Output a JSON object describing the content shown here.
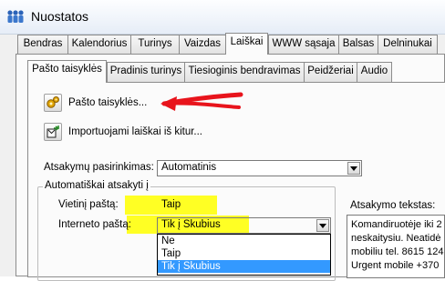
{
  "window": {
    "title": "Nuostatos"
  },
  "outer_tabs": [
    {
      "label": "Bendras"
    },
    {
      "label": "Kalendorius"
    },
    {
      "label": "Turinys"
    },
    {
      "label": "Vaizdas"
    },
    {
      "label": "Laiškai"
    },
    {
      "label": "WWW sąsaja"
    },
    {
      "label": "Balsas"
    },
    {
      "label": "Delninukai"
    }
  ],
  "outer_active_tab": "Laiškai",
  "inner_tabs": [
    {
      "label": "Pašto taisyklės"
    },
    {
      "label": "Pradinis turinys"
    },
    {
      "label": "Tiesioginis bendravimas"
    },
    {
      "label": "Peidžeriai"
    },
    {
      "label": "Audio"
    }
  ],
  "inner_active_tab": "Pašto taisyklės",
  "buttons": {
    "mail_rules": "Pašto taisyklės...",
    "import_mail": "Importuojami laiškai iš kitur..."
  },
  "reply_select": {
    "label": "Atsakymų pasirinkimas:",
    "value": "Automatinis"
  },
  "auto_reply_group": {
    "legend": "Automatiškai atsakyti į",
    "local_mail": {
      "label": "Vietinį paštą:",
      "value": "Taip"
    },
    "internet_mail": {
      "label": "Interneto paštą:",
      "value": "Tik į Skubius"
    },
    "options": [
      "Ne",
      "Taip",
      "Tik į Skubius"
    ],
    "selected_option": "Tik į Skubius"
  },
  "reply_text": {
    "label": "Atsakymo tekstas:",
    "lines": [
      "Komandiruotėje iki 2",
      "neskaitysiu. Neatidė",
      "mobiliu tel. 8615 124",
      "Urgent mobile +370"
    ]
  },
  "colors": {
    "highlight": "#ffff24",
    "annotation_arrow": "#e8141c",
    "selection": "#3399ff"
  }
}
